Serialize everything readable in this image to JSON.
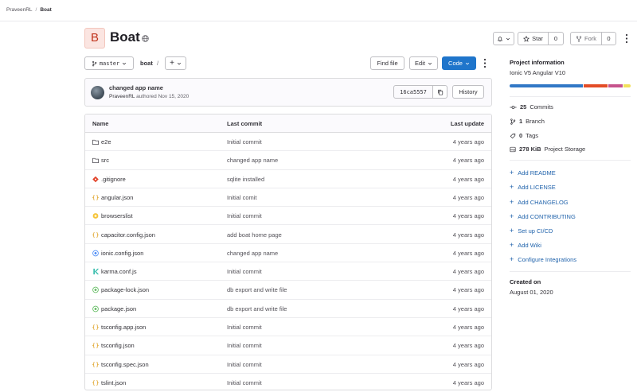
{
  "breadcrumb": {
    "owner": "PraveenRL",
    "project": "Boat"
  },
  "project": {
    "avatar_letter": "B",
    "name": "Boat"
  },
  "actions": {
    "notify_chevron": "",
    "star_label": "Star",
    "star_count": "0",
    "fork_label": "Fork",
    "fork_count": "0"
  },
  "toolbar": {
    "branch": "master",
    "path_root": "boat",
    "path_sep": "/",
    "add_label": "+",
    "find_file": "Find file",
    "edit": "Edit",
    "code": "Code"
  },
  "last_commit": {
    "title": "changed app name",
    "author": "PraveenRL",
    "authored": "authored",
    "date": "Nov 15, 2020",
    "sha": "16ca5557",
    "history": "History"
  },
  "table": {
    "headers": {
      "name": "Name",
      "last_commit": "Last commit",
      "last_update": "Last update"
    },
    "rows": [
      {
        "name": "e2e",
        "commit": "Initial commit",
        "updated": "4 years ago",
        "icon": "folder-icon"
      },
      {
        "name": "src",
        "commit": "changed app name",
        "updated": "4 years ago",
        "icon": "folder-icon"
      },
      {
        "name": ".gitignore",
        "commit": "sqlite installed",
        "updated": "4 years ago",
        "icon": "git-icon"
      },
      {
        "name": "angular.json",
        "commit": "Initial comit",
        "updated": "4 years ago",
        "icon": "json-icon"
      },
      {
        "name": "browserslist",
        "commit": "Initial commit",
        "updated": "4 years ago",
        "icon": "browserslist-icon"
      },
      {
        "name": "capacitor.config.json",
        "commit": "add boat home page",
        "updated": "4 years ago",
        "icon": "json-icon"
      },
      {
        "name": "ionic.config.json",
        "commit": "changed app name",
        "updated": "4 years ago",
        "icon": "ionic-icon"
      },
      {
        "name": "karma.conf.js",
        "commit": "Initial commit",
        "updated": "4 years ago",
        "icon": "karma-icon"
      },
      {
        "name": "package-lock.json",
        "commit": "db export and write file",
        "updated": "4 years ago",
        "icon": "npm-icon"
      },
      {
        "name": "package.json",
        "commit": "db export and write file",
        "updated": "4 years ago",
        "icon": "npm-icon"
      },
      {
        "name": "tsconfig.app.json",
        "commit": "Initial commit",
        "updated": "4 years ago",
        "icon": "json-icon"
      },
      {
        "name": "tsconfig.json",
        "commit": "Initial commit",
        "updated": "4 years ago",
        "icon": "json-icon"
      },
      {
        "name": "tsconfig.spec.json",
        "commit": "Initial commit",
        "updated": "4 years ago",
        "icon": "json-icon"
      },
      {
        "name": "tslint.json",
        "commit": "Initial commit",
        "updated": "4 years ago",
        "icon": "json-icon"
      }
    ]
  },
  "sidebar": {
    "info_title": "Project information",
    "description": "Ionic V5 Angular V10",
    "languages": [
      {
        "share": 62,
        "color": "#3178c6"
      },
      {
        "share": 20,
        "color": "#e34c26"
      },
      {
        "share": 12,
        "color": "#c6538c"
      },
      {
        "share": 6,
        "color": "#f1e05a"
      }
    ],
    "commits_count": "25",
    "commits_label": "Commits",
    "branch_count": "1",
    "branch_label": "Branch",
    "tags_count": "0",
    "tags_label": "Tags",
    "storage_size": "278 KiB",
    "storage_label": "Project Storage",
    "links": [
      "Add README",
      "Add LICENSE",
      "Add CHANGELOG",
      "Add CONTRIBUTING",
      "Set up CI/CD",
      "Add Wiki",
      "Configure Integrations"
    ],
    "created_title": "Created on",
    "created_date": "August 01, 2020"
  },
  "colors": {
    "primary": "#1f75cb",
    "link": "#1f62ab",
    "project_avatar_bg": "#fbe5e1"
  }
}
